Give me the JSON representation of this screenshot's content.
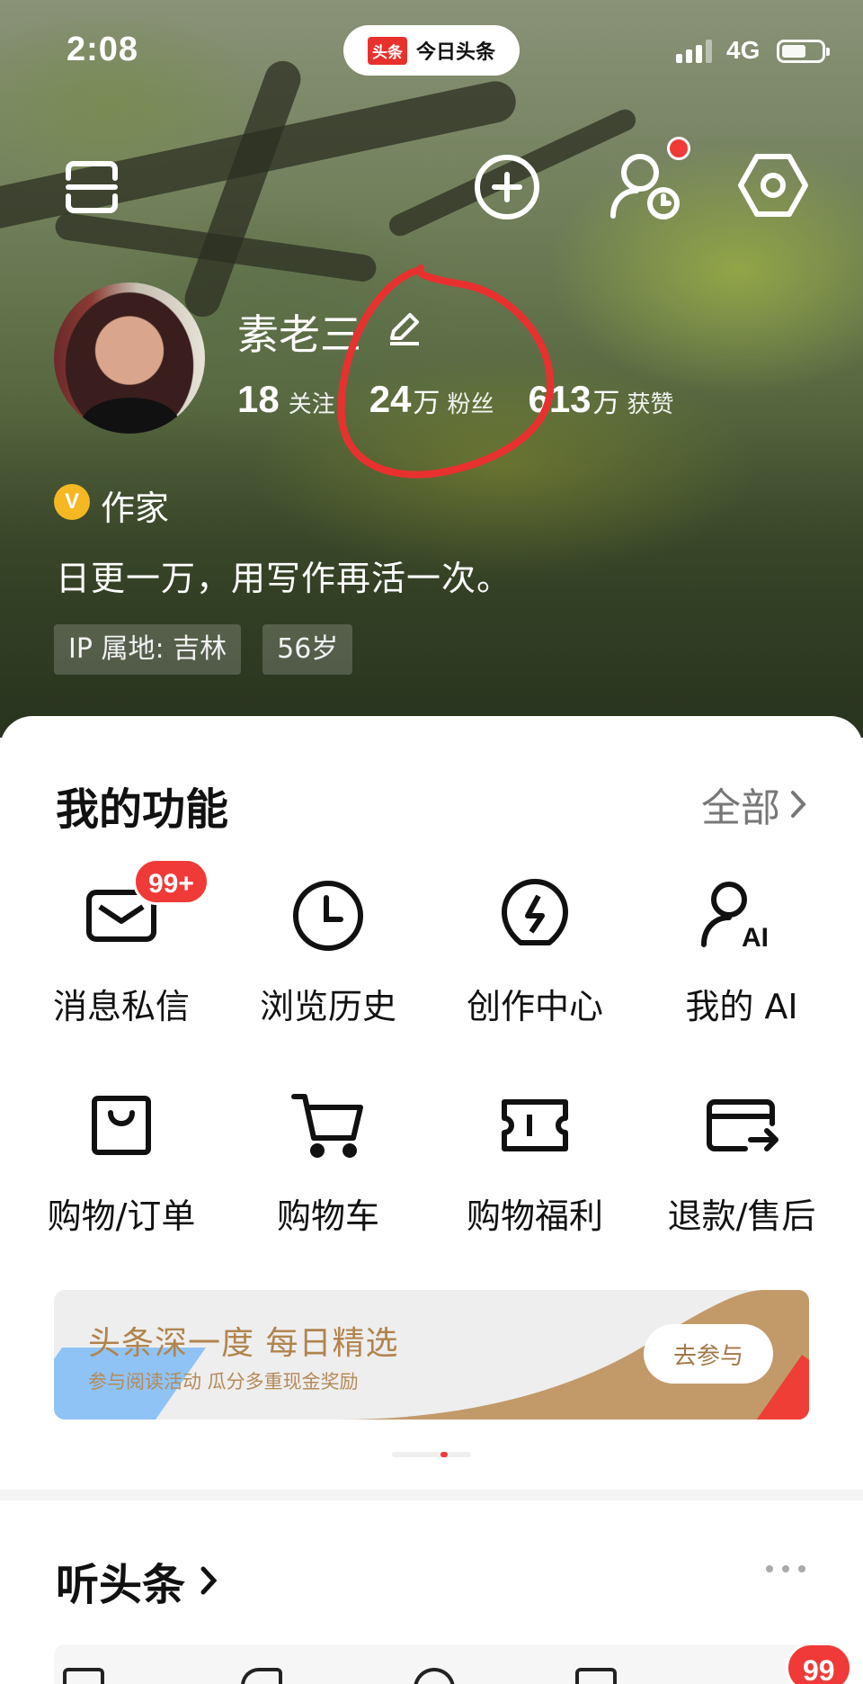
{
  "status_bar": {
    "time": "2:08",
    "app_badge": "头条",
    "app_name": "今日头条",
    "network": "4G"
  },
  "profile": {
    "name": "素老三",
    "stats": [
      {
        "value": "18",
        "unit": "",
        "label": "关注"
      },
      {
        "value": "24",
        "unit": "万",
        "label": "粉丝"
      },
      {
        "value": "613",
        "unit": "万",
        "label": "获赞"
      }
    ],
    "verified_badge": "V",
    "verified_title": "作家",
    "bio": "日更一万，用写作再活一次。",
    "tags": [
      "IP 属地: 吉林",
      "56岁"
    ]
  },
  "functions": {
    "title": "我的功能",
    "all_label": "全部",
    "items": [
      {
        "label": "消息私信",
        "icon": "mail-icon",
        "badge": "99+"
      },
      {
        "label": "浏览历史",
        "icon": "clock-icon"
      },
      {
        "label": "创作中心",
        "icon": "lightning-bulb-icon"
      },
      {
        "label": "我的 AI",
        "icon": "ai-user-icon"
      },
      {
        "label": "购物/订单",
        "icon": "shopping-bag-icon"
      },
      {
        "label": "购物车",
        "icon": "cart-icon"
      },
      {
        "label": "购物福利",
        "icon": "ticket-icon"
      },
      {
        "label": "退款/售后",
        "icon": "refund-card-icon"
      }
    ]
  },
  "banner": {
    "title": "头条深一度 每日精选",
    "subtitle": "参与阅读活动 瓜分多重现金奖励",
    "button": "去参与"
  },
  "listen": {
    "title": "听头条",
    "badge": "99"
  },
  "colors": {
    "accent_red": "#f03a38",
    "verified_gold": "#f5b823",
    "banner_gold": "#c29a6a"
  }
}
